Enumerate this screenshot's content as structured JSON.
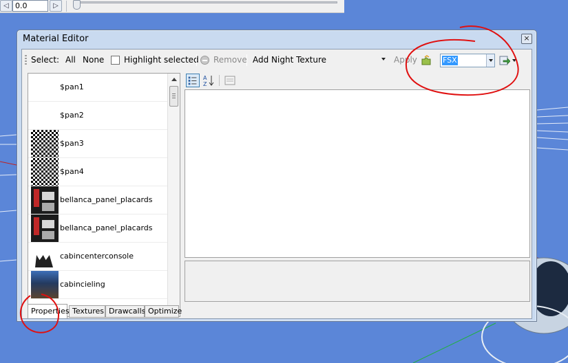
{
  "timeline": {
    "frame_value": "0.0",
    "prev_icon": "rewind-icon",
    "next_icon": "step-forward-icon"
  },
  "window": {
    "title": "Material Editor",
    "close_label": "×"
  },
  "toolbar": {
    "select_label": "Select:",
    "all_label": "All",
    "none_label": "None",
    "highlight_label": "Highlight selected",
    "remove_label": "Remove",
    "night_texture_value": "Add Night Texture",
    "apply_label": "Apply",
    "format_value": "FSX"
  },
  "materials": [
    {
      "name": "$pan1",
      "thumb": "none"
    },
    {
      "name": "$pan2",
      "thumb": "none"
    },
    {
      "name": "$pan3",
      "thumb": "checker"
    },
    {
      "name": "$pan4",
      "thumb": "checker"
    },
    {
      "name": "bellanca_panel_placards",
      "thumb": "panel"
    },
    {
      "name": "bellanca_panel_placards",
      "thumb": "panel"
    },
    {
      "name": "cabincenterconsole",
      "thumb": "console"
    },
    {
      "name": "cabincieling",
      "thumb": "ceiling"
    }
  ],
  "tabs": [
    {
      "label": "Properties",
      "active": true
    },
    {
      "label": "Textures",
      "active": false
    },
    {
      "label": "Drawcalls",
      "active": false
    },
    {
      "label": "Optimize",
      "active": false
    }
  ],
  "colors": {
    "annotation": "#e01010",
    "desktop": "#5b86d8",
    "selection": "#3399ff"
  }
}
